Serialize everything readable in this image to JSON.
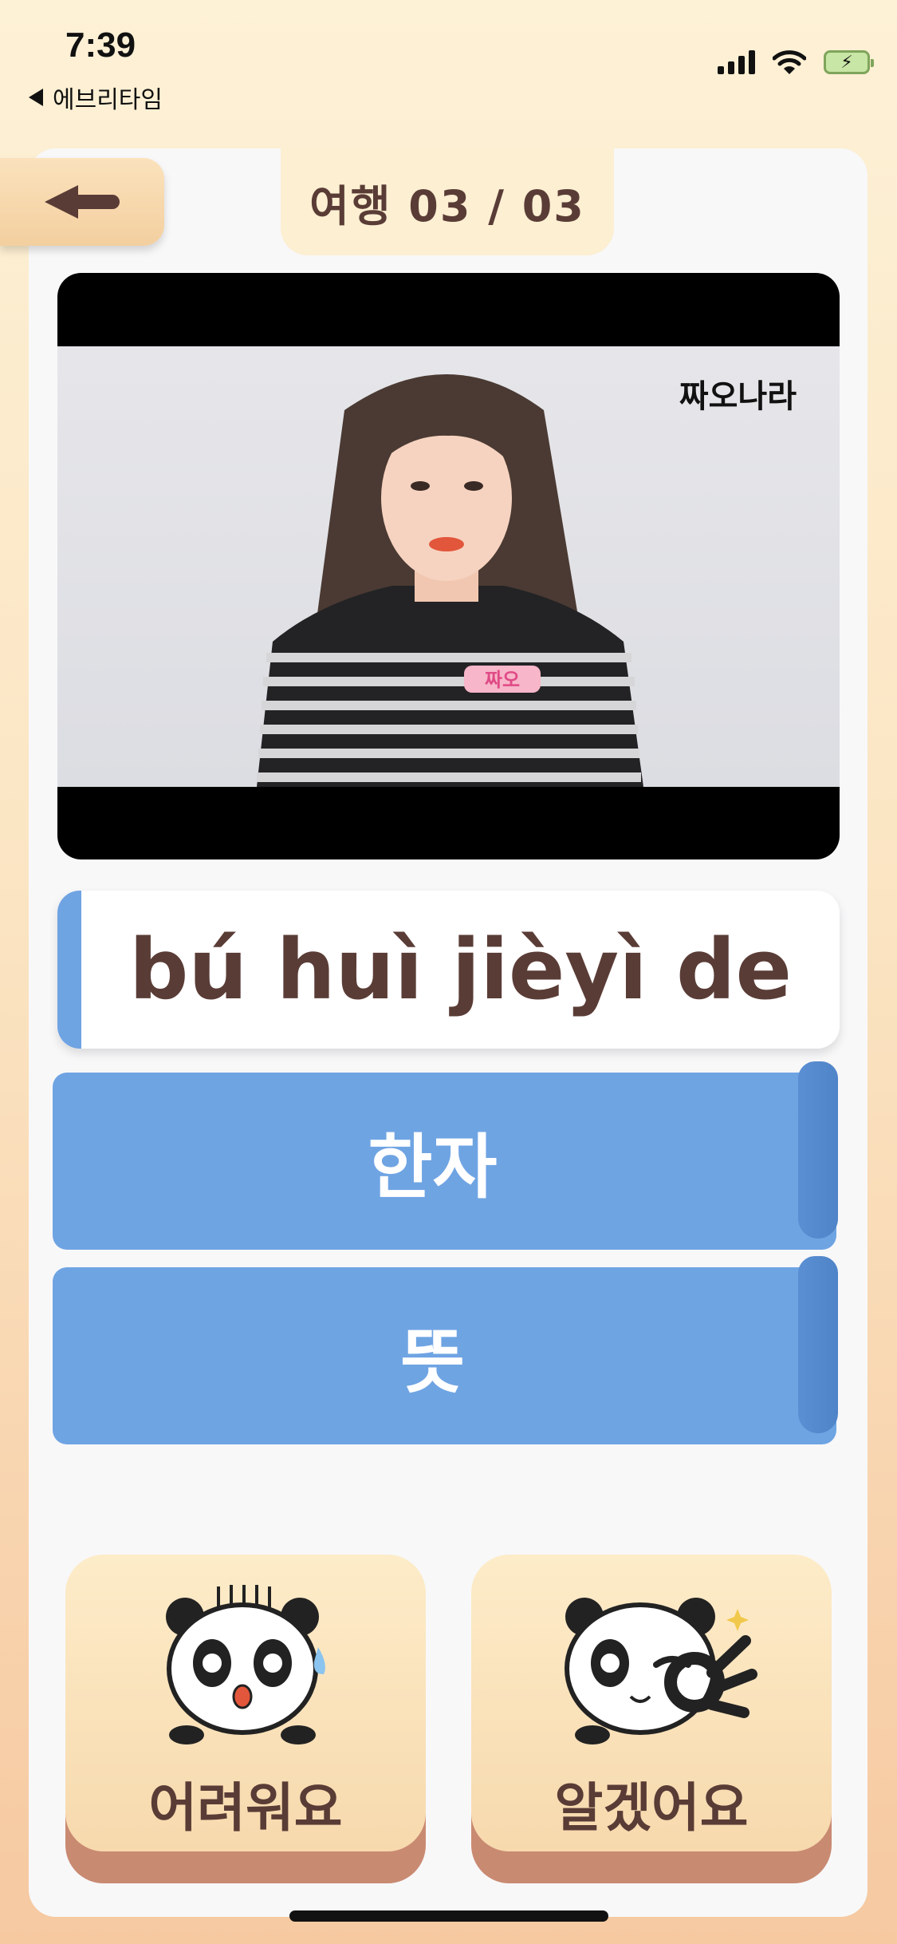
{
  "status_bar": {
    "time": "7:39",
    "back_app": "에브리타임"
  },
  "header": {
    "title": "여행 03 / 03"
  },
  "video": {
    "watermark": "짜오나라",
    "shirt_logo": "짜오"
  },
  "card": {
    "pinyin": "bú huì jièyì de"
  },
  "reveal_buttons": [
    {
      "label": "한자"
    },
    {
      "label": "뜻"
    }
  ],
  "rating_buttons": [
    {
      "label": "어려워요"
    },
    {
      "label": "알겠어요"
    }
  ],
  "colors": {
    "accent_blue": "#6fa4e3",
    "text_brown": "#5a3c36",
    "tab_cream": "#fcefd2"
  }
}
